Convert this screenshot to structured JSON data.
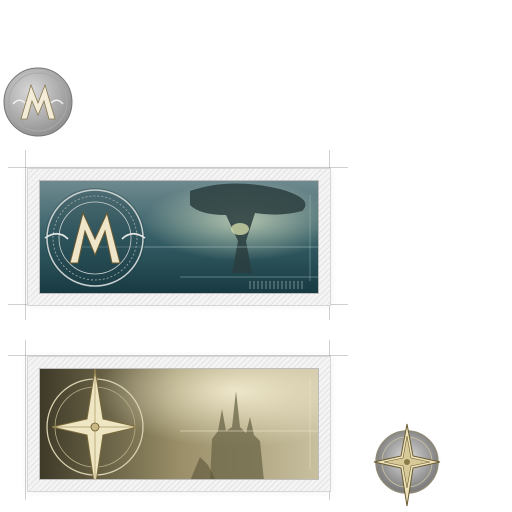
{
  "assets": {
    "small_emblem": {
      "icon": "m-crest-emblem-icon"
    },
    "card_storm": {
      "icon": "m-crest-emblem-icon",
      "theme": "teal-storm",
      "accent": "#2f5a62"
    },
    "card_castle": {
      "icon": "compass-star-icon",
      "theme": "golden-mist-castle",
      "accent": "#8a7a4a"
    },
    "small_compass": {
      "icon": "compass-star-icon"
    }
  },
  "colors": {
    "silver": "#c8c8c8",
    "gold": "#e8dcb0",
    "teal": "#2f5a62",
    "olive": "#6b6340"
  }
}
